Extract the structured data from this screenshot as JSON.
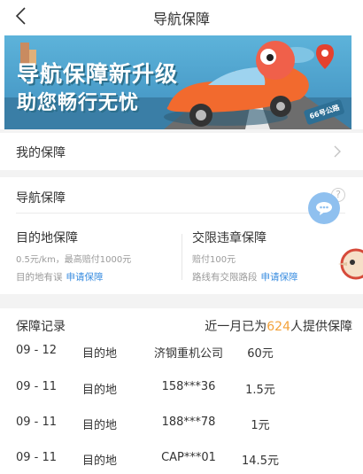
{
  "header": {
    "title": "导航保障",
    "back_icon": "back-arrow-icon"
  },
  "banner": {
    "line1": "导航保障新升级",
    "line2": "助您畅行无忧",
    "sign": "66号公路",
    "colors": {
      "sky": "#4aa3cf",
      "road": "#6d6d6d",
      "car": "#f26a2e",
      "mascot": "#f0604a"
    }
  },
  "my_guarantee": {
    "label": "我的保障",
    "chevron_icon": "chevron-right-icon"
  },
  "nav_guarantee": {
    "heading": "导航保障",
    "destination": {
      "title": "目的地保障",
      "subtitle": "0.5元/km，最高赔付1000元",
      "condition": "目的地有误",
      "action": "申请保障"
    },
    "violation": {
      "title": "交限违章保障",
      "subtitle": "赔付100元",
      "condition": "路线有交限路段",
      "action": "申请保障"
    },
    "help_icon": "question-icon"
  },
  "floating_button": {
    "icon": "chat-bubble-icon",
    "color": "#8fc0ef"
  },
  "records": {
    "heading": "保障记录",
    "summary_prefix": "近一月已为",
    "summary_count": "624",
    "summary_suffix": "人提供保障",
    "accent": "#f3a23a",
    "rows": [
      {
        "date": "09 - 12",
        "type": "目的地",
        "user": "济钢重机公司",
        "amount": "60元"
      },
      {
        "date": "09 - 11",
        "type": "目的地",
        "user": "158***36",
        "amount": "1.5元"
      },
      {
        "date": "09 - 11",
        "type": "目的地",
        "user": "188***78",
        "amount": "1元"
      },
      {
        "date": "09 - 11",
        "type": "目的地",
        "user": "CAP***01",
        "amount": "14.5元"
      }
    ]
  }
}
